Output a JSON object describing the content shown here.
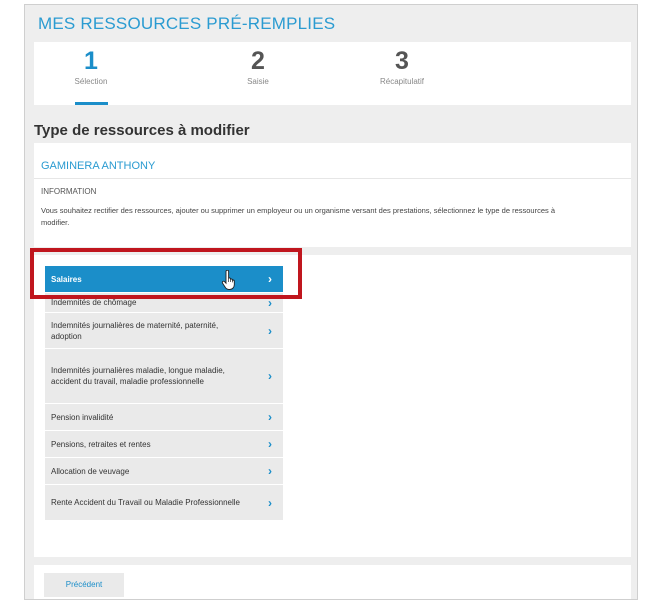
{
  "page": {
    "title": "MES RESSOURCES PRÉ-REMPLIES"
  },
  "stepper": {
    "steps": [
      {
        "number": "1",
        "label": "Sélection"
      },
      {
        "number": "2",
        "label": "Saisie"
      },
      {
        "number": "3",
        "label": "Récapitulatif"
      }
    ],
    "active_index": 0
  },
  "section": {
    "title": "Type de ressources à modifier"
  },
  "info": {
    "name": "GAMINERA ANTHONY",
    "heading": "INFORMATION",
    "text": "Vous souhaitez rectifier des ressources, ajouter ou supprimer un employeur ou un organisme versant des prestations, sélectionnez le type de ressources à modifier."
  },
  "resource_types": {
    "selected_index": 0,
    "items": [
      {
        "label": "Salaires"
      },
      {
        "label": "Indemnités de chômage"
      },
      {
        "label": "Indemnités journalières de maternité, paternité, adoption"
      },
      {
        "label": "Indemnités journalières maladie, longue maladie, accident du travail, maladie professionnelle"
      },
      {
        "label": "Pension invalidité"
      },
      {
        "label": "Pensions, retraites et rentes"
      },
      {
        "label": "Allocation de veuvage"
      },
      {
        "label": "Rente Accident du Travail ou Maladie Professionnelle"
      }
    ],
    "chevron": "›"
  },
  "footer": {
    "prev_label": "Précédent"
  },
  "colors": {
    "accent": "#1b8ec9",
    "title": "#2a9bd1",
    "highlight": "#c0161e"
  },
  "icons": {
    "cursor": "hand-pointer-icon",
    "chevron": "chevron-right-icon"
  }
}
